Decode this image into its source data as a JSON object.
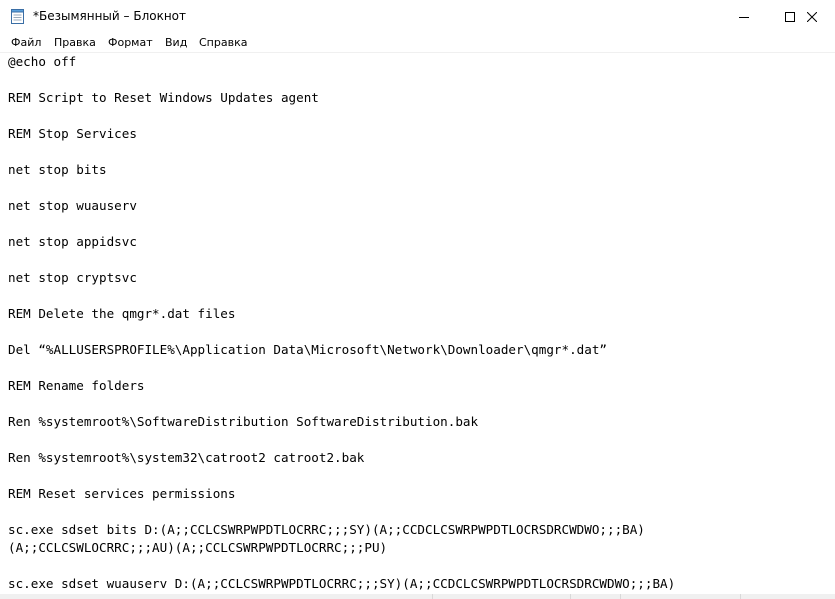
{
  "window": {
    "title": "*Безымянный – Блокнот",
    "app_icon": "notepad-icon",
    "controls": [
      "minimize-icon",
      "maximize-icon",
      "close-icon"
    ]
  },
  "menu": {
    "items": [
      {
        "label": "Файл"
      },
      {
        "label": "Правка"
      },
      {
        "label": "Формат"
      },
      {
        "label": "Вид"
      },
      {
        "label": "Справка"
      }
    ]
  },
  "editor": {
    "lines": [
      "@echo off",
      "REM Script to Reset Windows Updates agent",
      "REM Stop Services",
      "net stop bits",
      "net stop wuauserv",
      "net stop appidsvc",
      "net stop cryptsvc",
      "REM Delete the qmgr*.dat files",
      "Del “%ALLUSERSPROFILE%\\Application Data\\Microsoft\\Network\\Downloader\\qmgr*.dat”",
      "REM Rename folders",
      "Ren %systemroot%\\SoftwareDistribution SoftwareDistribution.bak",
      "Ren %systemroot%\\system32\\catroot2 catroot2.bak",
      "REM Reset services permissions",
      "sc.exe sdset bits D:(A;;CCLCSWRPWPDTLOCRRC;;;SY)(A;;CCDCLCSWRPWPDTLOCRSDRCWDWO;;;BA)",
      "(A;;CCLCSWLOCRRC;;;AU)(A;;CCLCSWRPWPDTLOCRRC;;;PU)",
      "sc.exe sdset wuauserv D:(A;;CCLCSWRPWPDTLOCRRC;;;SY)(A;;CCDCLCSWRPWPDTLOCRSDRCWDWO;;;BA)"
    ]
  },
  "colors": {
    "background": "#ffffff",
    "text": "#000000",
    "statusbar": "#f0f0f0"
  }
}
